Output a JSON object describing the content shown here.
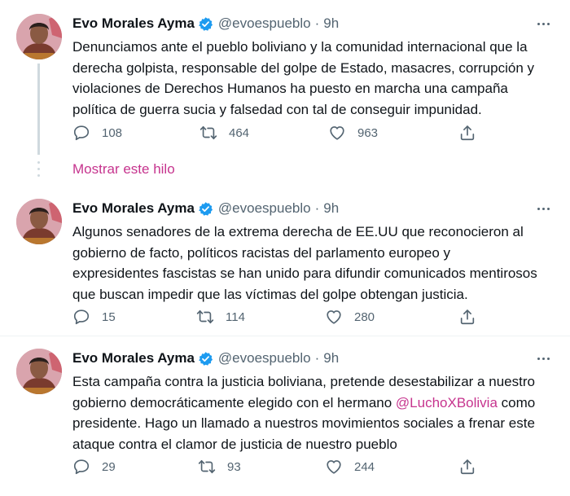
{
  "tweets": [
    {
      "author": "Evo Morales Ayma",
      "handle": "@evoespueblo",
      "separator": "·",
      "time": "9h",
      "lines": [
        "Denunciamos ante el pueblo boliviano y la comunidad internacional que la",
        "derecha golpista, responsable del golpe de Estado, masacres, corrupción y",
        "violaciones de Derechos Humanos ha puesto en marcha una campaña",
        "política de guerra sucia y falsedad con tal de conseguir impunidad."
      ],
      "replies": "108",
      "retweets": "464",
      "likes": "963"
    },
    {
      "author": "Evo Morales Ayma",
      "handle": "@evoespueblo",
      "separator": "·",
      "time": "9h",
      "lines": [
        "Algunos senadores de la extrema derecha de EE.UU que reconocieron al",
        "gobierno de facto, políticos racistas del parlamento europeo y",
        "expresidentes fascistas se han unido para difundir comunicados mentirosos",
        "que buscan impedir que las víctimas del golpe obtengan justicia."
      ],
      "replies": "15",
      "retweets": "114",
      "likes": "280"
    },
    {
      "author": "Evo Morales Ayma",
      "handle": "@evoespueblo",
      "separator": "·",
      "time": "9h",
      "line1": "Esta campaña contra la justicia boliviana, pretende desestabilizar a nuestro",
      "line2_before": "gobierno democráticamente elegido con el hermano ",
      "mention": "@LuchoXBolivia",
      "line2_after": " como",
      "line3": "presidente. Hago un llamado a nuestros movimientos sociales a frenar este",
      "line4": "ataque contra el clamor de justicia de nuestro pueblo",
      "replies": "29",
      "retweets": "93",
      "likes": "244"
    }
  ],
  "show_thread_label": "Mostrar este hilo",
  "colors": {
    "text": "#0f1419",
    "secondary": "#536471",
    "accent": "#c6348e",
    "verified": "#1d9bf0"
  },
  "icons": [
    "verified-badge-icon",
    "more-options-icon",
    "reply-icon",
    "retweet-icon",
    "like-icon",
    "share-icon"
  ]
}
